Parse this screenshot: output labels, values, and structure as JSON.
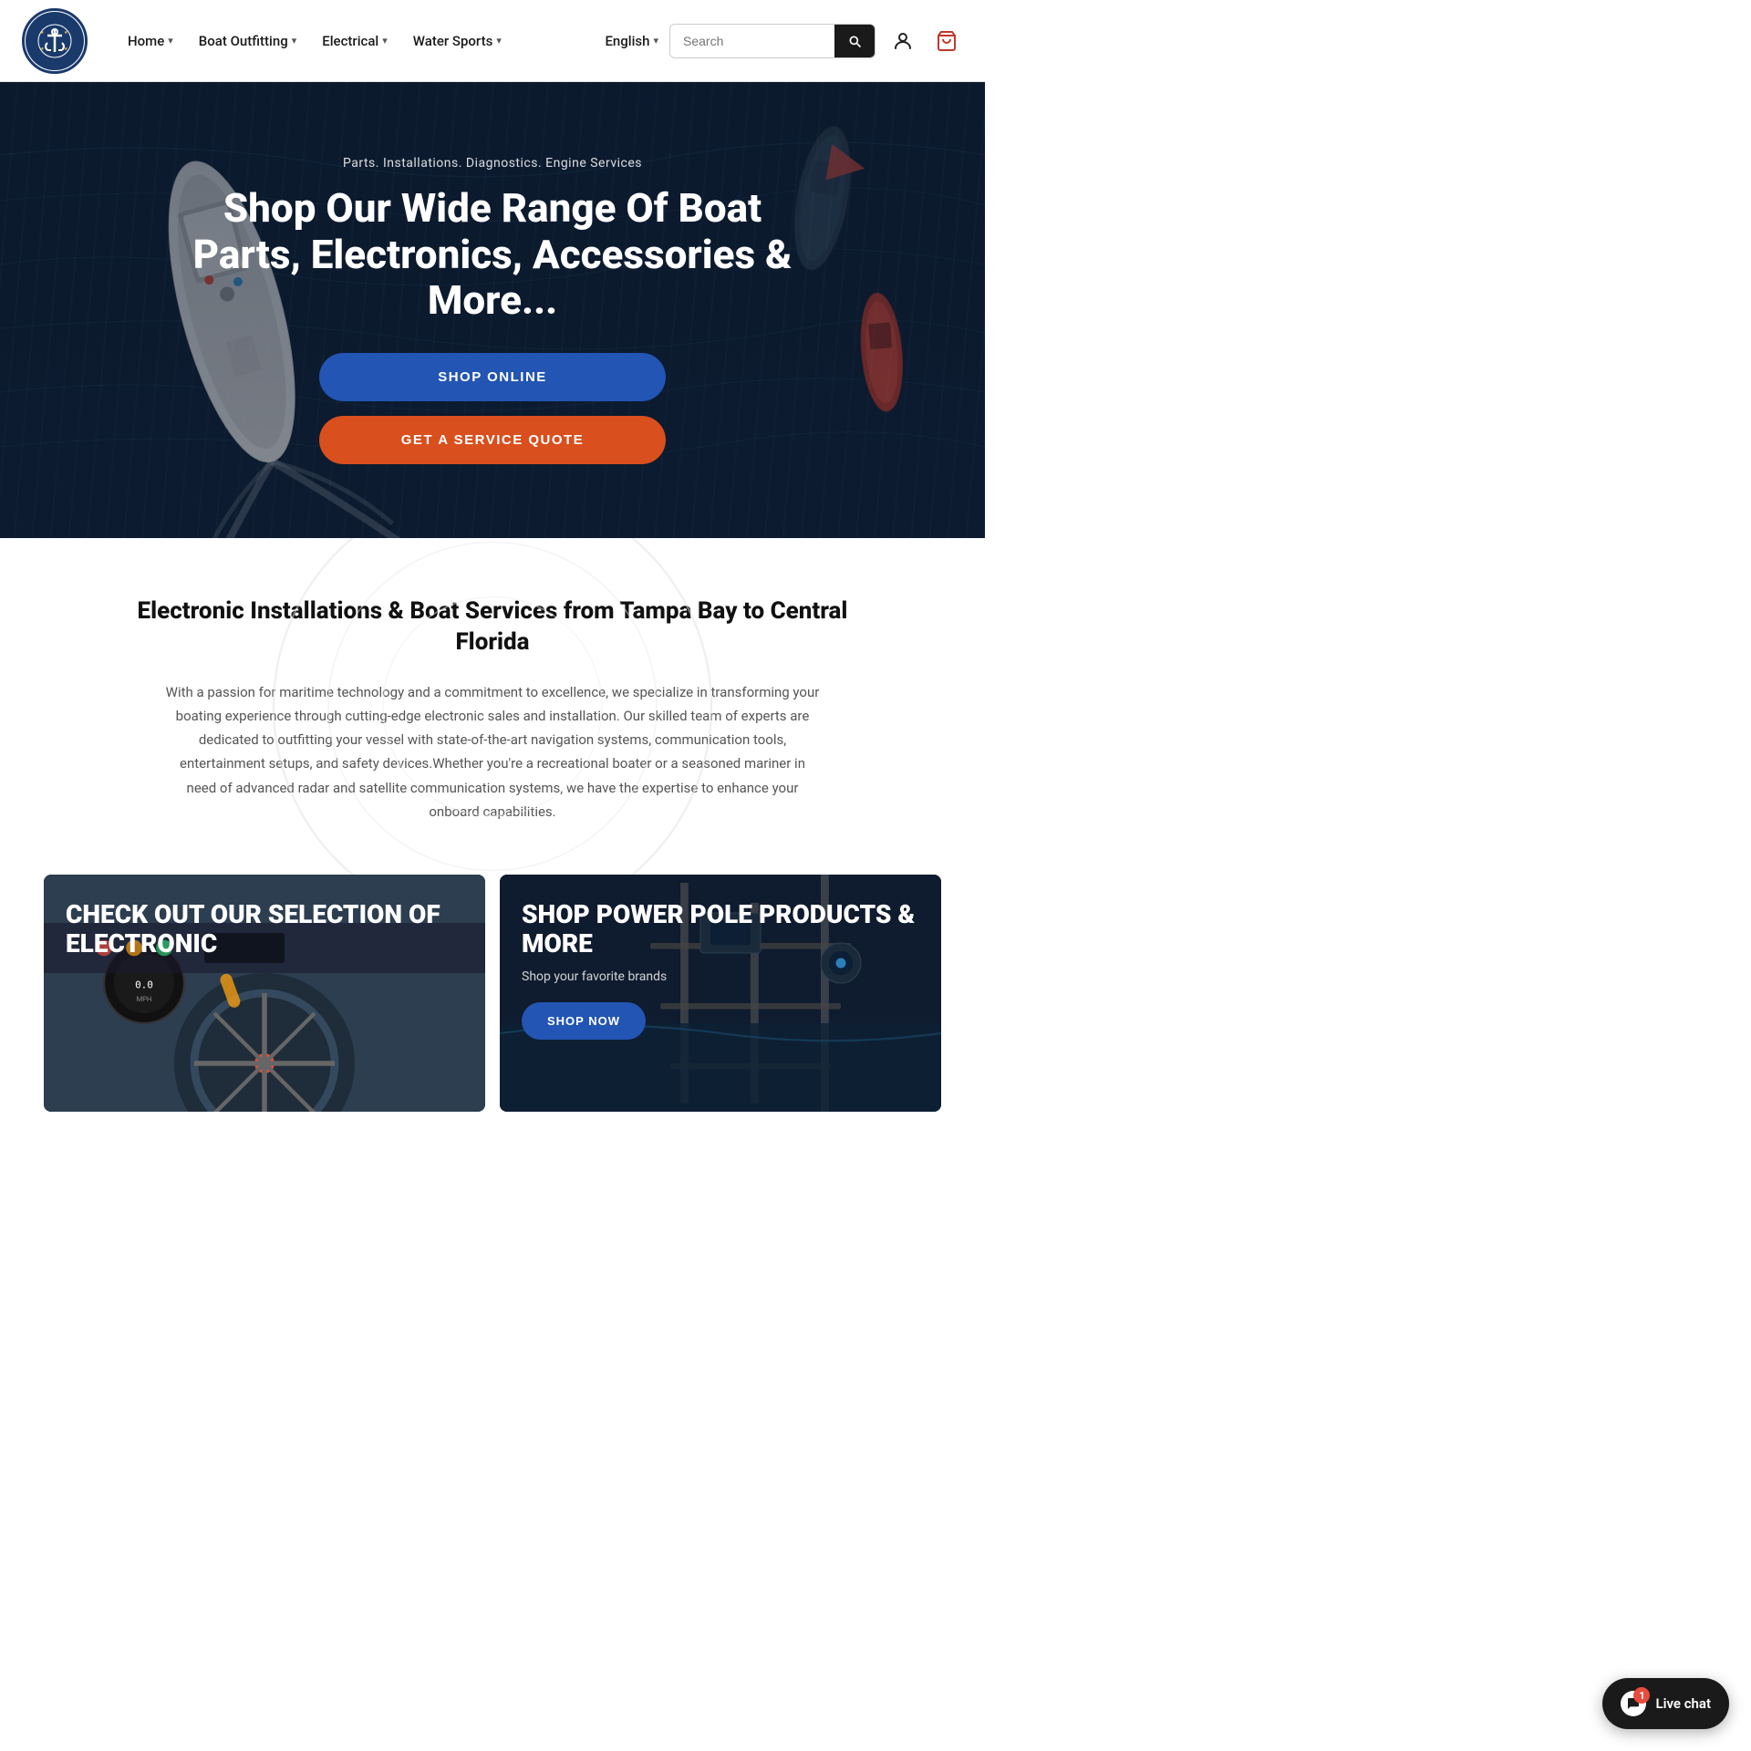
{
  "site": {
    "logo_alt": "Essential Marine Services",
    "logo_initials": "⚓"
  },
  "navbar": {
    "home_label": "Home",
    "boat_outfitting_label": "Boat Outfitting",
    "electrical_label": "Electrical",
    "water_sports_label": "Water Sports",
    "english_label": "English",
    "search_placeholder": "Search",
    "search_button_label": "Search"
  },
  "hero": {
    "sub_label": "Parts. Installations. Diagnostics. Engine Services",
    "title": "Shop Our Wide Range Of Boat Parts, Electronics, Accessories & More...",
    "shop_online_label": "SHOP ONLINE",
    "get_quote_label": "GET A SERVICE QUOTE"
  },
  "about": {
    "title": "Electronic Installations & Boat Services from Tampa Bay to Central Florida",
    "body": "With a passion for maritime technology and a commitment to excellence, we specialize in transforming your boating experience through cutting-edge electronic sales and installation. Our skilled team of experts are dedicated to outfitting your vessel with state-of-the-art navigation systems, communication tools, entertainment setups, and safety devices.Whether you're a recreational boater or a seasoned mariner in need of advanced radar and satellite communication systems, we have the expertise to enhance your onboard capabilities."
  },
  "cards": [
    {
      "title": "CHECK OUT OUR SELECTION OF ELECTRONIC",
      "sub": "",
      "cta": null
    },
    {
      "title": "SHOP POWER POLE PRODUCTS & MORE",
      "sub": "Shop your favorite brands",
      "cta": "SHOP NOW"
    }
  ],
  "live_chat": {
    "label": "Live chat",
    "badge": "1"
  },
  "icons": {
    "chevron": "›",
    "search": "search",
    "user": "user",
    "cart": "cart",
    "chat": "💬"
  }
}
